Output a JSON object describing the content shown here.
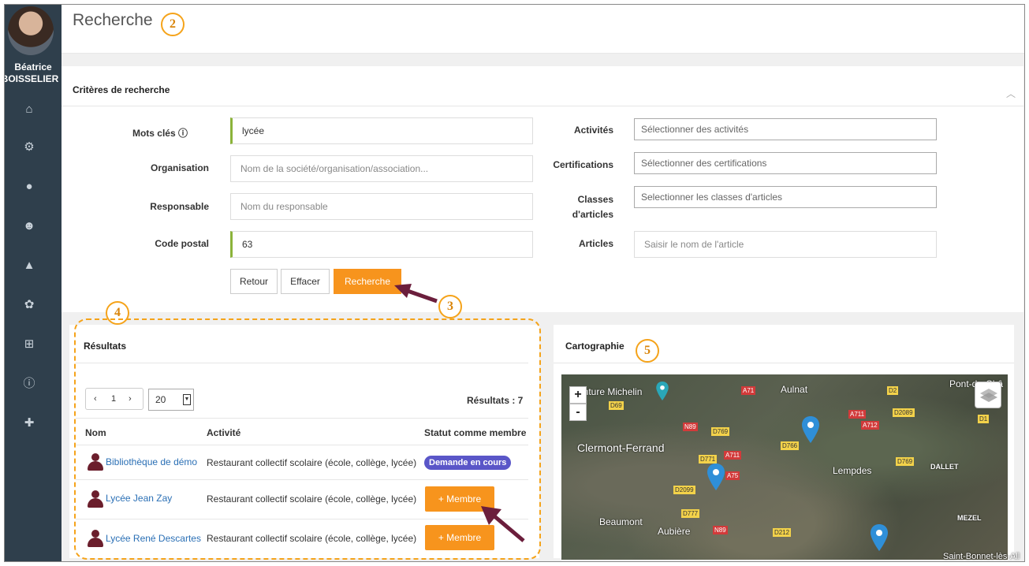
{
  "user": {
    "first_name": "Béatrice",
    "last_name": "BOISSELIER"
  },
  "header": {
    "title": "Recherche"
  },
  "annotations": [
    "2",
    "3",
    "4",
    "5"
  ],
  "criteria": {
    "title": "Critères de recherche",
    "fields": {
      "keywords": {
        "label": "Mots clés",
        "value": "lycée"
      },
      "organisation": {
        "label": "Organisation",
        "placeholder": "Nom de la société/organisation/association..."
      },
      "manager": {
        "label": "Responsable",
        "placeholder": "Nom du responsable"
      },
      "postal_code": {
        "label": "Code postal",
        "value": "63"
      },
      "activities": {
        "label": "Activités",
        "placeholder": "Sélectionner des activités"
      },
      "certifications": {
        "label": "Certifications",
        "placeholder": "Sélectionner des certifications"
      },
      "classes_line1": "Classes",
      "classes_line2": "d'articles",
      "classes_placeholder": "Selectionner les classes d'articles",
      "articles": {
        "label": "Articles",
        "placeholder": "Saisir le nom de l'article"
      }
    },
    "buttons": {
      "back": "Retour",
      "clear": "Effacer",
      "search": "Recherche"
    }
  },
  "results": {
    "title": "Résultats",
    "pager": {
      "prev": "‹",
      "page": "1",
      "next": "›"
    },
    "page_size": "20",
    "count": "Résultats : 7",
    "columns": {
      "name": "Nom",
      "activity": "Activité",
      "status": "Statut comme membre"
    },
    "rows": [
      {
        "name": "Bibliothèque de démo",
        "activity": "Restaurant collectif scolaire (école, collège, lycée)",
        "status": "Demande en cours"
      },
      {
        "name": "Lycée Jean Zay",
        "activity": "Restaurant collectif scolaire (école, collège, lycée)",
        "status": "+ Membre"
      },
      {
        "name": "Lycée René Descartes",
        "activity": "Restaurant collectif scolaire (école, collège, lycée)",
        "status": "+ Membre"
      }
    ]
  },
  "map": {
    "title": "Cartographie",
    "zoom_in": "+",
    "zoom_out": "-",
    "labels": {
      "michelin": "enture Michelin",
      "clermont": "Clermont-Ferrand",
      "aulnat": "Aulnat",
      "pont": "Pont-du-Châ",
      "lempdes": "Lempdes",
      "dallet": "DALLET",
      "beaumont": "Beaumont",
      "aubiere": "Aubière",
      "mezel": "MEZEL",
      "stbonnet": "Saint-Bonnet-lès-All"
    },
    "roads": [
      "D69",
      "A71",
      "D2",
      "A711",
      "D2089",
      "A712",
      "D1",
      "N89",
      "D769",
      "D766",
      "D771",
      "A711",
      "A75",
      "D769",
      "D2099",
      "D777",
      "N89",
      "D212"
    ]
  },
  "colors": {
    "accent": "#f7941d",
    "sidebar": "#2f3f4c",
    "status_pill": "#5a56c8",
    "annotation": "#f5a31a",
    "arrow": "#6b1e3c"
  }
}
